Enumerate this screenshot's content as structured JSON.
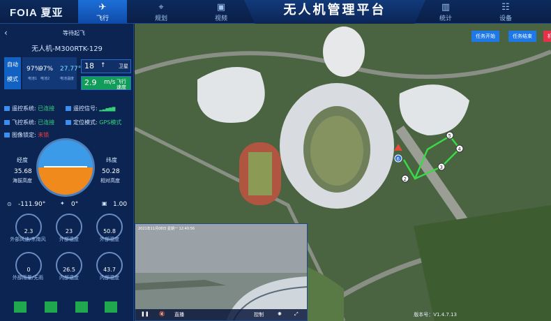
{
  "header": {
    "logo": "FOIA 夏亚",
    "title": "无人机管理平台",
    "tabs": [
      {
        "label": "飞行",
        "icon": "plane-icon",
        "active": true
      },
      {
        "label": "规划",
        "icon": "plan-icon"
      },
      {
        "label": "视频",
        "icon": "video-icon"
      },
      {
        "label": "统计",
        "icon": "stats-icon"
      },
      {
        "label": "设备",
        "icon": "device-icon"
      }
    ]
  },
  "drone": {
    "status": "等待起飞",
    "name": "无人机-M300RTK-129",
    "mode": [
      "自动",
      "模式"
    ],
    "battery1": "97%",
    "battery2": "97%",
    "battery1_label": "电池1",
    "battery2_label": "电池2",
    "battery_temp": "27.77℃",
    "battery_temp_label": "电池温度",
    "satellites": "18",
    "satellites_label": "卫星",
    "speed": "2.9",
    "speed_unit": "m/s",
    "speed_label": "飞行速度"
  },
  "systems": [
    {
      "label": "遥控系统:",
      "value": "已连接",
      "color": "#35d27a"
    },
    {
      "label": "遥控信号:",
      "value": "▂▃▅▆▇",
      "color": "#35d27a"
    },
    {
      "label": "飞控系统:",
      "value": "已连接",
      "color": "#35d27a"
    },
    {
      "label": "定位模式:",
      "value": "GPS模式",
      "color": "#35d27a"
    },
    {
      "label": "图像锁定:",
      "value": "未锁",
      "color": "#ff3b3b"
    }
  ],
  "attitude": {
    "left_label": "经度",
    "left_value": "35.68",
    "left_sub": "海拔高度",
    "right_label": "纬度",
    "right_value": "50.28",
    "right_sub": "相对高度"
  },
  "heading": {
    "value": "-111.90°",
    "pitch": "0°",
    "zoom": "1.00"
  },
  "gauges": [
    {
      "value": "2.3",
      "label": "外部风速/东南风"
    },
    {
      "value": "23",
      "label": "外部温度"
    },
    {
      "value": "50.8",
      "label": "外部湿度"
    },
    {
      "value": "0",
      "label": "外部雨量/无雨"
    },
    {
      "value": "26.5",
      "label": "内部温度"
    },
    {
      "value": "43.7",
      "label": "内部湿度"
    }
  ],
  "map": {
    "buttons": {
      "start": "任务开始",
      "end": "任务结束",
      "more": "机"
    },
    "waypoints": [
      "2",
      "3",
      "4",
      "5",
      "6"
    ],
    "version": "版本号：V1.4.7.13"
  },
  "video": {
    "timestamp": "2021年11月08日 星期一 12:40:56",
    "live_label": "直播",
    "ptz_label": "控制"
  }
}
